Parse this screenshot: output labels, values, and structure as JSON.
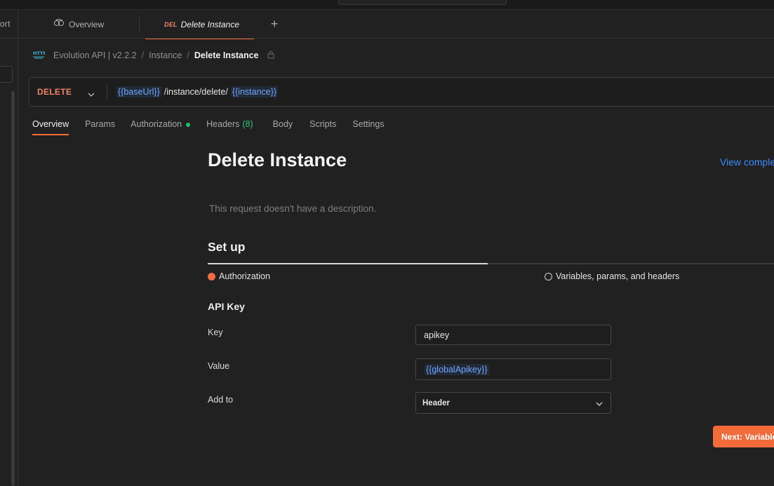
{
  "sidebar": {
    "import_fragment": "ort"
  },
  "tabs": {
    "overview_label": "Overview",
    "active_method": "DEL",
    "active_label": "Delete Instance",
    "add_label": "+"
  },
  "breadcrumb": {
    "icon": "http-icon",
    "collection": "Evolution API | v2.2.2",
    "folder": "Instance",
    "current": "Delete Instance",
    "separator": "/"
  },
  "request": {
    "method": "DELETE",
    "method_color": "#f0836a",
    "url_parts": {
      "base_var": "{{baseUrl}}",
      "path": "/instance/delete/",
      "instance_var": "{{instance}}"
    }
  },
  "request_tabs": {
    "overview": "Overview",
    "params": "Params",
    "authorization": "Authorization",
    "headers": "Headers",
    "headers_count": "(8)",
    "body": "Body",
    "scripts": "Scripts",
    "settings": "Settings"
  },
  "docs": {
    "title": "Delete Instance",
    "view_complete": "View complete documentation",
    "description": "This request doesn't have a description.",
    "setup_title": "Set up",
    "setup_progress": 0.5,
    "steps": {
      "authorization": "Authorization",
      "variables": "Variables, params, and headers"
    },
    "auth_section": "API Key",
    "fields": {
      "key_label": "Key",
      "key_value": "apikey",
      "value_label": "Value",
      "value_value": "{{globalApikey}}",
      "addto_label": "Add to",
      "addto_value": "Header"
    },
    "next_button": "Next: Variables"
  },
  "colors": {
    "accent": "#f26b3a",
    "variable": "#6fa6ff",
    "link": "#3d8bff",
    "status_green": "#1fbf63"
  }
}
